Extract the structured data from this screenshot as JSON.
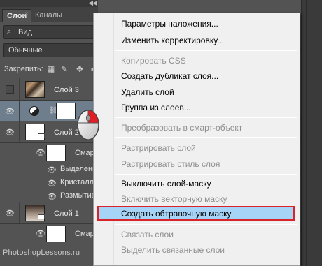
{
  "panel": {
    "tabs": [
      {
        "label": "Слои"
      },
      {
        "label": "Каналы"
      }
    ],
    "tab_close": "×",
    "top_arrows": "◀◀",
    "filter": {
      "icon": "search-icon",
      "label": "Вид"
    },
    "blend_mode": "Обычные",
    "lock_label": "Закрепить:",
    "layers": [
      {
        "name": "Слой 3",
        "visible": false
      },
      {
        "name": "",
        "visible": true,
        "selected": true
      },
      {
        "name": "Слой 2",
        "visible": true
      },
      {
        "name": "Смарт",
        "sub": true
      },
      {
        "name": "Выделение",
        "sub": true
      },
      {
        "name": "Кристалли",
        "sub": true
      },
      {
        "name": "Размытие",
        "sub": true
      },
      {
        "name": "Слой 1",
        "visible": true
      },
      {
        "name": "Смарт",
        "sub": true
      }
    ],
    "watermark": "PhotoshopLessons.ru"
  },
  "menu": {
    "items": [
      {
        "label": "Параметры наложения...",
        "enabled": true
      },
      {
        "label": "Изменить корректировку...",
        "enabled": true
      },
      {
        "label": "Копировать CSS",
        "enabled": false
      },
      {
        "label": "Создать дубликат слоя...",
        "enabled": true
      },
      {
        "label": "Удалить слой",
        "enabled": true
      },
      {
        "label": "Группа из слоев...",
        "enabled": true
      },
      {
        "label": "Преобразовать в смарт-объект",
        "enabled": false
      },
      {
        "label": "Растрировать слой",
        "enabled": false
      },
      {
        "label": "Растрировать стиль слоя",
        "enabled": false
      },
      {
        "label": "Выключить слой-маску",
        "enabled": true
      },
      {
        "label": "Включить векторную маску",
        "enabled": false
      },
      {
        "label": "Создать обтравочную маску",
        "enabled": true,
        "highlighted": true
      },
      {
        "label": "Связать слои",
        "enabled": false
      },
      {
        "label": "Выделить связанные слои",
        "enabled": false
      }
    ],
    "highlight_color": "#a6d4f7",
    "highlight_border": "#d9232b"
  }
}
